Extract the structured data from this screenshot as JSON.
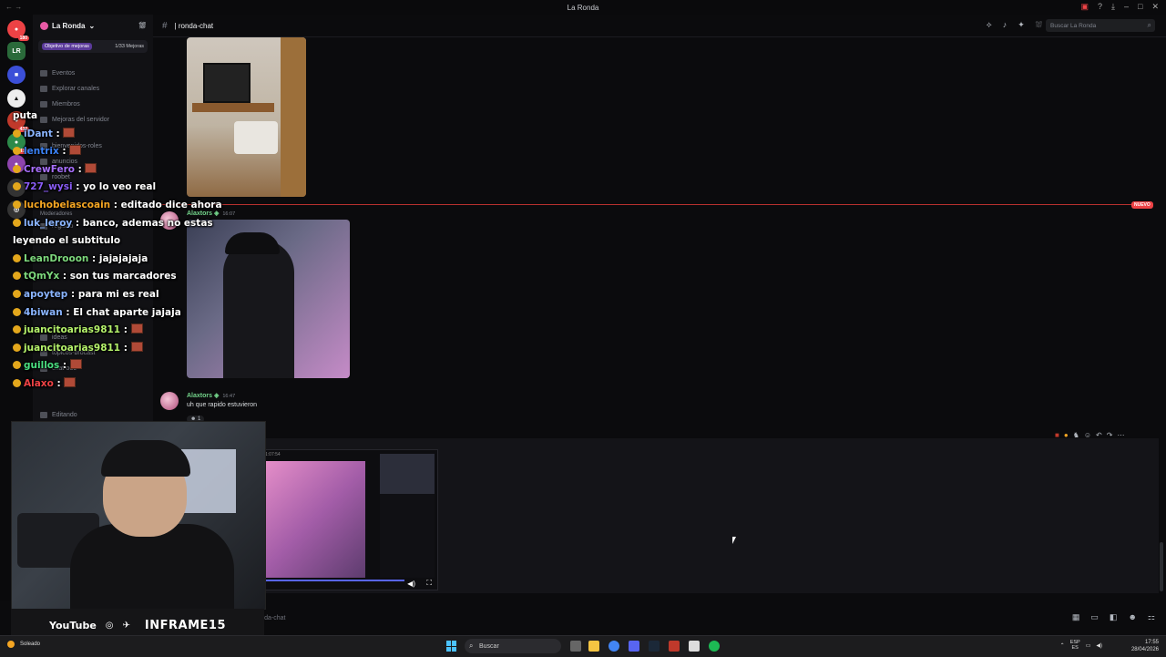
{
  "window": {
    "title": "La Ronda"
  },
  "server": {
    "name": "La Ronda",
    "badge_count": "180",
    "srv_badge_1": "434",
    "srv_badge_2": "414"
  },
  "boost": {
    "label": "Objetivo de mejoras",
    "count": "1/33 Mejoras"
  },
  "channels": {
    "items": [
      "Eventos",
      "Explorar canales",
      "Miembros",
      "Mejoras del servidor",
      "bienvenidos-roles",
      "anuncios",
      "roobet",
      "Moderadores",
      "registro",
      "ideas",
      "topicos-brocast",
      "chat-ooc"
    ],
    "status": "Editando"
  },
  "chat": {
    "channel_name": "| ronda-chat",
    "search_placeholder": "Buscar La Ronda",
    "new_tag": "NUEVO",
    "composer_placeholder": "ronda-chat"
  },
  "messages": [
    {
      "author": "Alaxtors",
      "time": "16:07"
    },
    {
      "author": "Alaxtors",
      "time": "16:47",
      "text": "uh que rapido estuvieron",
      "reaction": "1"
    }
  ],
  "twitch_chat": [
    {
      "user": "puta",
      "text": ""
    },
    {
      "user": "iDant",
      "text": " : "
    },
    {
      "user": "lentrix",
      "text": " : "
    },
    {
      "user": "CrewFero",
      "text": " : "
    },
    {
      "user": "727_wysi",
      "text": " : yo lo veo real"
    },
    {
      "user": "luchobelascoain",
      "text": " : editado dice ahora"
    },
    {
      "user": "luk_leroy",
      "text": " : banco, ademas no estas leyendo el subtitulo"
    },
    {
      "user": "LeanDrooon",
      "text": " : jajajajaja"
    },
    {
      "user": "tQmYx",
      "text": " : son tus marcadores"
    },
    {
      "user": "apoytep",
      "text": " : para mi es real"
    },
    {
      "user": "4biwan",
      "text": " : El chat aparte jajaja"
    },
    {
      "user": "juancitoarias9811",
      "text": " : "
    },
    {
      "user": "juancitoarias9811",
      "text": " : "
    },
    {
      "user": "guillos",
      "text": " : "
    },
    {
      "user": "Alaxo",
      "text": " : "
    }
  ],
  "twitch_colors": [
    "#ffffff",
    "#8ab4ff",
    "#3b82f6",
    "#a970ff",
    "#8a5cf6",
    "#f5a623",
    "#8ab4ff",
    "#7dd87d",
    "#7dd87d",
    "#8ab4ff",
    "#8ab4ff",
    "#b5f26b",
    "#b5f26b",
    "#4ade80",
    "#ed4245"
  ],
  "stream": {
    "time_label": "1:07:54"
  },
  "overlay": {
    "youtube": "YouTube",
    "channel": "INFRAME15"
  },
  "taskbar": {
    "weather": "Soleado",
    "search": "Buscar",
    "lang1": "ESP",
    "lang2": "ES",
    "time": "17:55",
    "date": "28/04/2026"
  }
}
